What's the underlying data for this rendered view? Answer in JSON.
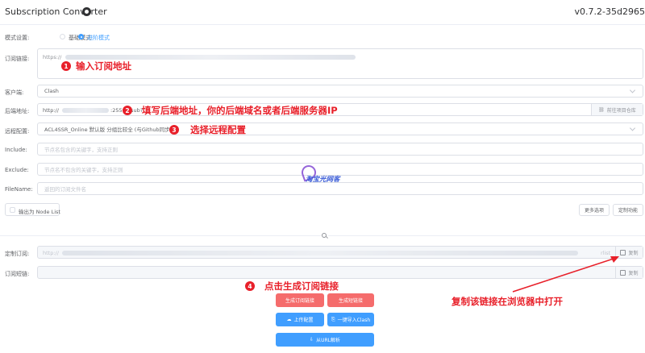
{
  "header": {
    "title": "Subscription Converter",
    "version": "v0.7.2-35d2965"
  },
  "mode": {
    "label": "模式设置:",
    "options": [
      "基础模式",
      "进阶模式"
    ],
    "selected": "进阶模式"
  },
  "sub_url": {
    "label": "订阅链接:",
    "value_prefix": "https://"
  },
  "client": {
    "label": "客户端:",
    "value": "Clash"
  },
  "backend": {
    "label": "后端地址:",
    "value_prefix": "http://",
    "value_suffix": ":25500/sub?",
    "append_label": "前往项目仓库"
  },
  "remote_config": {
    "label": "远程配置:",
    "value": "ACL4SSR_Online 默认版 分组比较全 (与Github同步)"
  },
  "include": {
    "label": "Include:",
    "placeholder": "节点名包含的关键字，支持正则"
  },
  "exclude": {
    "label": "Exclude:",
    "placeholder": "节点名不包含的关键字，支持正则"
  },
  "filename": {
    "label": "FileName:",
    "placeholder": "返回的订阅文件名"
  },
  "node_list": {
    "label": "输出为 Node List"
  },
  "more_options": {
    "label": "更多选项"
  },
  "custom_func": {
    "label": "定制功能"
  },
  "custom_sub": {
    "label": "定制订阅:",
    "value_prefix": "http://",
    "value_tail": "rlist",
    "copy_label": "复制"
  },
  "short_link": {
    "label": "订阅短链:",
    "copy_label": "复制"
  },
  "actions": {
    "gen_sub": "生成订阅链接",
    "gen_short": "生成短链接",
    "upload_config": "上传配置",
    "import_clash": "一键导入Clash",
    "parse_url": "从URL解析"
  },
  "annotations": {
    "step1": {
      "num": "1",
      "text": "输入订阅地址"
    },
    "step2": {
      "num": "2",
      "text": "填写后端地址，你的后端域名或者后端服务器IP"
    },
    "step3": {
      "num": "3",
      "text": "选择远程配置"
    },
    "step4": {
      "num": "4",
      "text": "点击生成订阅链接"
    },
    "copy_hint": "复制该链接在浏览器中打开"
  },
  "watermark": "淘宝光网客",
  "colors": {
    "primary": "#409eff",
    "danger": "#f56c6c",
    "annotation": "#e8202a"
  }
}
